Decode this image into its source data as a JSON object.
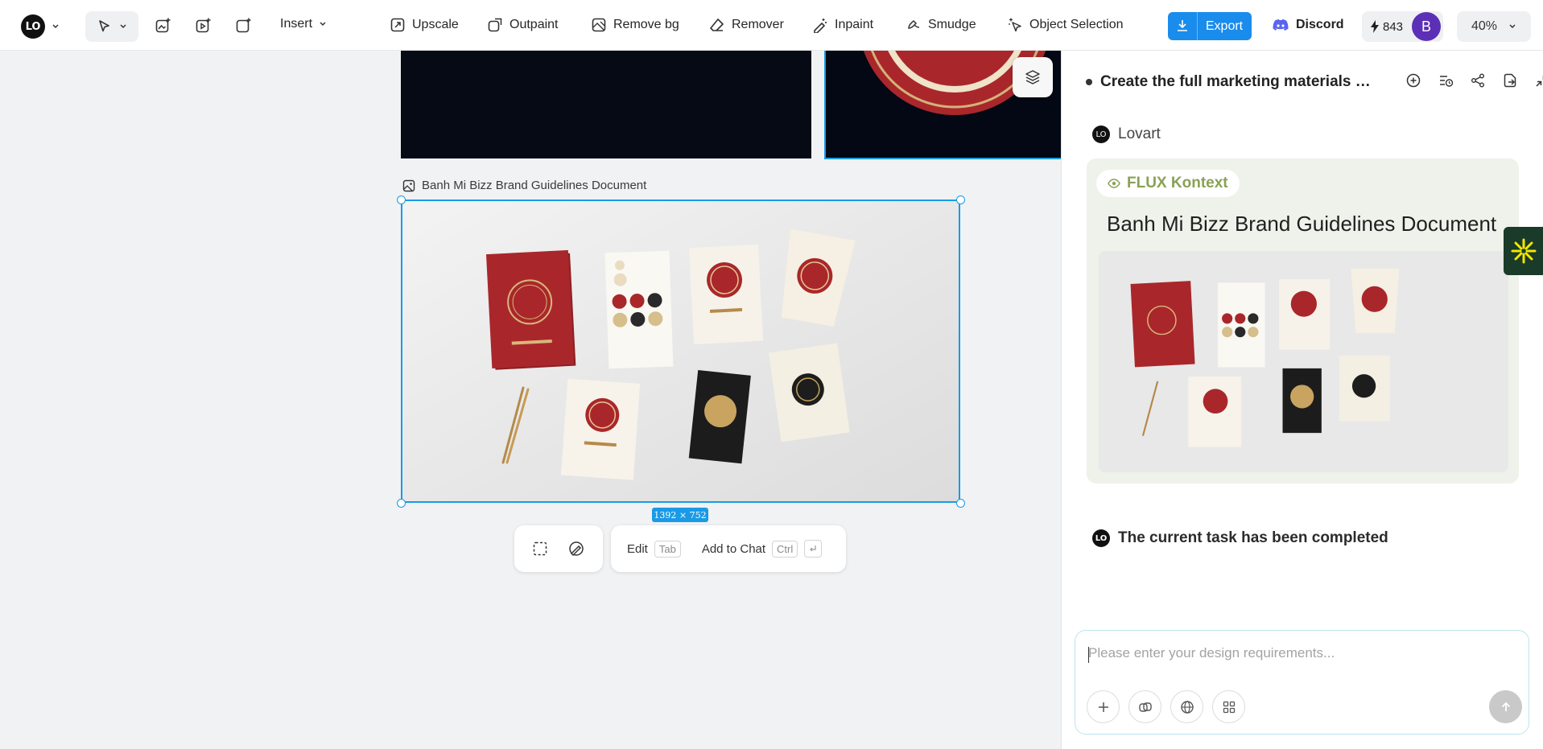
{
  "toolbar": {
    "insert_label": "Insert",
    "tools": [
      {
        "label": "Upscale",
        "icon": "upscale-icon"
      },
      {
        "label": "Outpaint",
        "icon": "outpaint-icon"
      },
      {
        "label": "Remove bg",
        "icon": "remove-bg-icon"
      },
      {
        "label": "Remover",
        "icon": "eraser-icon"
      },
      {
        "label": "Inpaint",
        "icon": "inpaint-icon"
      },
      {
        "label": "Smudge",
        "icon": "smudge-icon"
      },
      {
        "label": "Object Selection",
        "icon": "object-selection-icon"
      }
    ],
    "export_label": "Export",
    "discord_label": "Discord",
    "credits": "843",
    "avatar_initial": "B",
    "zoom": "40%"
  },
  "canvas": {
    "image_label": "Banh Mi Bizz Brand Guidelines Document",
    "dimensions": "1392 × 752",
    "edit_label": "Edit",
    "edit_key": "Tab",
    "add_to_chat_label": "Add to Chat",
    "add_to_chat_key": "Ctrl"
  },
  "panel": {
    "title": "Create the full marketing materials to...",
    "assistant_name": "Lovart",
    "model_badge": "FLUX Kontext",
    "card_title": "Banh Mi Bizz Brand Guidelines Document",
    "status": "The current task has been completed",
    "chat_placeholder": "Please enter your design requirements..."
  },
  "colors": {
    "accent": "#1a8cec",
    "selection": "#1a9ae6",
    "brand_red": "#a9272b",
    "flux_green": "#8aa155"
  }
}
